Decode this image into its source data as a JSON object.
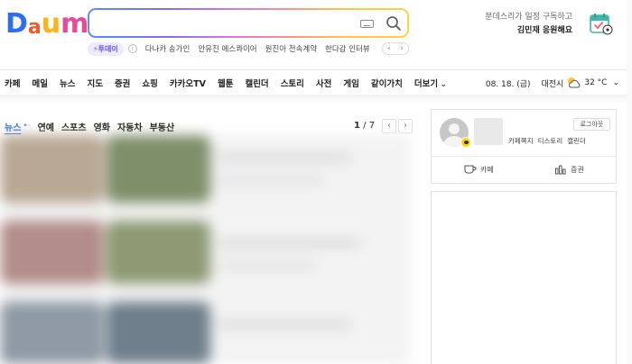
{
  "logo": {
    "letters": [
      "D",
      "a",
      "u",
      "m"
    ],
    "colors": [
      "#2f6cf5",
      "#f05a28",
      "#fbb415",
      "#e84a9a"
    ]
  },
  "search": {
    "value": "",
    "placeholder": ""
  },
  "trending": {
    "badge": "⚡투데이",
    "info": "i",
    "items": [
      "다나카 송가인",
      "안유진 에스콰이어",
      "원진아 전속계약",
      "한다감 인터뷰"
    ],
    "prev": "‹",
    "next": "›"
  },
  "promo": {
    "line1": "분데스리가 일정 구독하고",
    "line2": "김민재 응원해요"
  },
  "nav": {
    "items": [
      "카페",
      "메일",
      "뉴스",
      "지도",
      "증권",
      "쇼핑",
      "카카오TV",
      "웹툰",
      "캘린더",
      "스토리",
      "사전",
      "게임",
      "같이가치",
      "더보기"
    ],
    "more_chevron": "⌄"
  },
  "weather": {
    "date": "08. 18. (금)",
    "location": "대전시",
    "temperature": "32 °C",
    "chevron": "⌄"
  },
  "news": {
    "tabs": [
      "뉴스",
      "연예",
      "스포츠",
      "영화",
      "자동차",
      "부동산"
    ],
    "active_dots": "•·",
    "page_current": "1",
    "page_total": " / 7",
    "prev": "‹",
    "next": "›"
  },
  "login_panel": {
    "logout_label": "로그아웃",
    "links": [
      "카페쪽지",
      "티스토리",
      "캘린더"
    ],
    "cafe_label": "카페",
    "stock_label": "증권"
  },
  "colors": {
    "accent": "#1a73e8",
    "today_badge": "#6c4ff1",
    "kakao": "#ffd400"
  }
}
